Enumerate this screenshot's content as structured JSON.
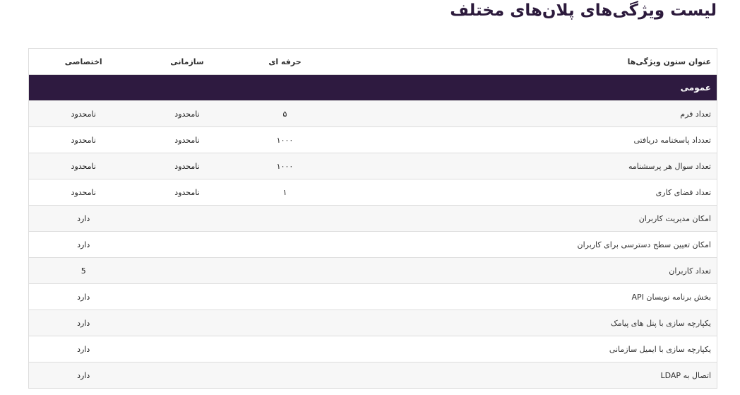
{
  "page": {
    "title": "لیست ویژگی‌های پلان‌های مختلف"
  },
  "table": {
    "headers": {
      "feature": "عنوان ستون ویژگی‌ها",
      "pro": "حرفه ای",
      "org": "سازمانی",
      "exclusive": "اختصاصی"
    },
    "section": "عمومی",
    "rows": [
      {
        "feature": "تعداد فرم",
        "pro": "۵",
        "org": "نامحدود",
        "exclusive": "نامحدود"
      },
      {
        "feature": "تعدداد پاسخنامه دریافتی",
        "pro": "۱۰۰۰",
        "org": "نامحدود",
        "exclusive": "نامحدود"
      },
      {
        "feature": "تعداد سوال هر پرسشنامه",
        "pro": "۱۰۰۰",
        "org": "نامحدود",
        "exclusive": "نامحدود"
      },
      {
        "feature": "تعداد فضای کاری",
        "pro": "۱",
        "org": "نامحدود",
        "exclusive": "نامحدود"
      },
      {
        "feature": "امکان مدیریت کاربران",
        "pro": "",
        "org": "",
        "exclusive": "دارد"
      },
      {
        "feature": "امکان تعیین سطح دسترسی برای کاربران",
        "pro": "",
        "org": "",
        "exclusive": "دارد"
      },
      {
        "feature": "تعداد کاربران",
        "pro": "",
        "org": "",
        "exclusive": "5"
      },
      {
        "feature": "بخش برنامه نویسان API",
        "pro": "",
        "org": "",
        "exclusive": "دارد"
      },
      {
        "feature": "یکپارچه سازی با پنل های پیامک",
        "pro": "",
        "org": "",
        "exclusive": "دارد"
      },
      {
        "feature": "یکپارچه سازی با ایمیل سازمانی",
        "pro": "",
        "org": "",
        "exclusive": "دارد"
      },
      {
        "feature": "اتصال به LDAP",
        "pro": "",
        "org": "",
        "exclusive": "دارد"
      }
    ]
  },
  "colors": {
    "title": "#2c1a3c",
    "section_bg": "#2e1a40",
    "row_alt": "#f7f7f7",
    "border": "#dddddd"
  }
}
